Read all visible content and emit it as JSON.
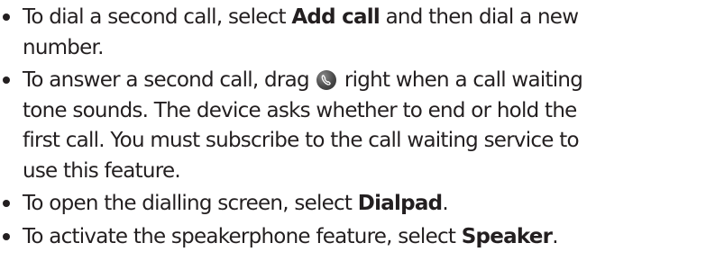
{
  "items": [
    {
      "pre": "To dial a second call, select ",
      "bold": "Add call",
      "post_line1": " and then dial a new",
      "post_line2": "number."
    },
    {
      "pre": "To answer a second call, drag ",
      "icon": "phone-answer-icon",
      "post_line1": " right when a call waiting",
      "line2": "tone sounds. The device asks whether to end or hold the",
      "line3": "first call. You must subscribe to the call waiting service to",
      "line4": "use this feature."
    },
    {
      "pre": "To open the dialling screen, select ",
      "bold": "Dialpad",
      "post": "."
    },
    {
      "pre": "To activate the speakerphone feature, select ",
      "bold": "Speaker",
      "post": "."
    }
  ]
}
